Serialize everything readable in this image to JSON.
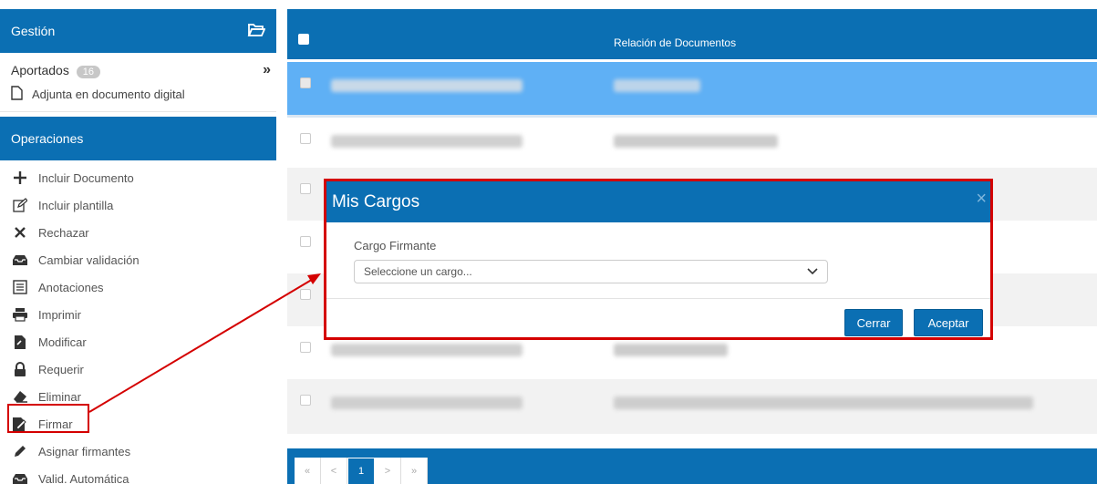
{
  "sidebar": {
    "gestion_title": "Gestión",
    "aportados_label": "Aportados",
    "aportados_count": "16",
    "adjunta_label": "Adjunta en documento digital",
    "operaciones_title": "Operaciones",
    "ops": [
      {
        "label": "Incluir Documento",
        "icon": "plus-icon"
      },
      {
        "label": "Incluir plantilla",
        "icon": "edit-icon"
      },
      {
        "label": "Rechazar",
        "icon": "x-icon"
      },
      {
        "label": "Cambiar validación",
        "icon": "inbox-icon"
      },
      {
        "label": "Anotaciones",
        "icon": "list-icon"
      },
      {
        "label": "Imprimir",
        "icon": "print-icon"
      },
      {
        "label": "Modificar",
        "icon": "file-edit-icon"
      },
      {
        "label": "Requerir",
        "icon": "lock-icon"
      },
      {
        "label": "Eliminar",
        "icon": "eraser-icon"
      },
      {
        "label": "Firmar",
        "icon": "sign-icon"
      },
      {
        "label": "Asignar firmantes",
        "icon": "pencil-icon"
      },
      {
        "label": "Valid. Automática",
        "icon": "inbox-icon"
      }
    ]
  },
  "table": {
    "header_title": "Relación de Documentos"
  },
  "pager": {
    "first": "«",
    "prev": "<",
    "page": "1",
    "next": ">",
    "last": "»"
  },
  "modal": {
    "title": "Mis Cargos",
    "close": "×",
    "field_label": "Cargo Firmante",
    "select_value": "Seleccione un cargo...",
    "cancel_label": "Cerrar",
    "accept_label": "Aceptar"
  },
  "colors": {
    "primary": "#0b6fb3",
    "highlight": "#d40000",
    "selected_row": "#5fb0f5"
  }
}
